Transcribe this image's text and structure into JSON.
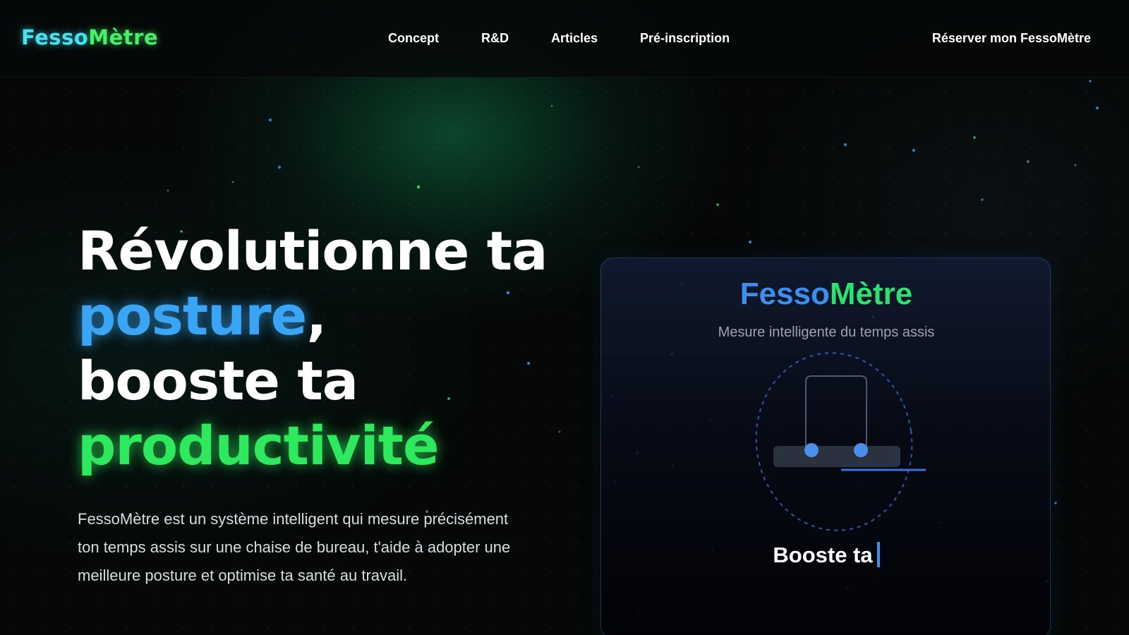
{
  "nav": {
    "logo": {
      "part1": "Fesso",
      "part2": "Mètre"
    },
    "links": [
      "Concept",
      "R&D",
      "Articles",
      "Pré-inscription"
    ],
    "cta": "Réserver mon FessoMètre"
  },
  "hero": {
    "title": {
      "line1": "Révolutionne ta",
      "line2_highlight": "posture",
      "line2_punct": ",",
      "line3": "booste ta",
      "line4_highlight": "productivité"
    },
    "description": "FessoMètre est un système intelligent qui mesure précisément ton temps assis sur une chaise de bureau, t'aide à adopter une meilleure posture et optimise ta santé au travail."
  },
  "card": {
    "title_part1": "Fesso",
    "title_part2": "Mètre",
    "subtitle": "Mesure intelligente du temps assis",
    "typing_text": "Booste ta"
  },
  "colors": {
    "accent_blue": "#3aa4f5",
    "accent_green": "#2ee85e",
    "logo_cyan": "#45e3f0",
    "background": "#050807"
  },
  "icons": [
    "chair-sensor-illustration"
  ]
}
